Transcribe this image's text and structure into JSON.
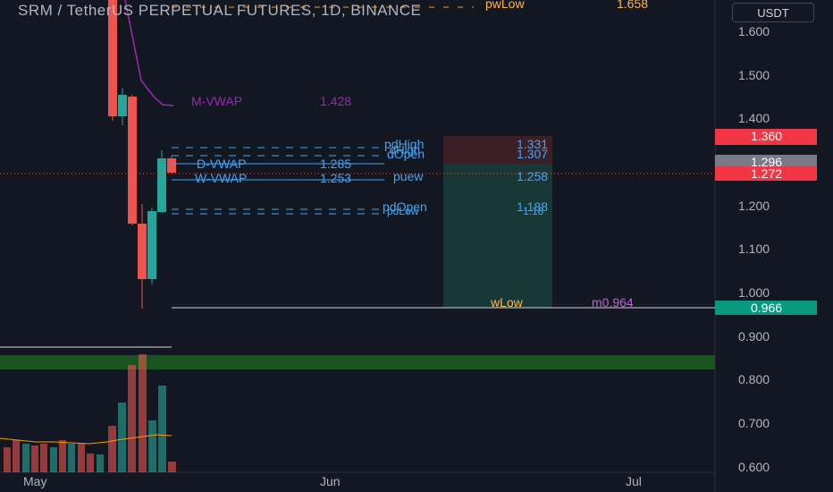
{
  "header": {
    "title": "SRM / TetherUS PERPETUAL FUTURES, 1D, BINANCE",
    "currency": "USDT"
  },
  "price_axis": {
    "ticks": [
      "1.600",
      "1.500",
      "1.400",
      "1.200",
      "1.100",
      "1.000",
      "0.900",
      "0.800",
      "0.700",
      "0.600"
    ],
    "badges": [
      {
        "label": "1.360",
        "color": "#f23645"
      },
      {
        "label": "1.296",
        "color": "#787b86"
      },
      {
        "label": "1.272",
        "color": "#f23645"
      },
      {
        "label": "0.966",
        "color": "#089981"
      }
    ]
  },
  "time_axis": {
    "ticks": [
      "May",
      "Jun",
      "Jul"
    ]
  },
  "indicators": {
    "pw_low_label": "pwLow",
    "pw_low_value": "1.658",
    "m_vwap_label": "M-VWAP",
    "m_vwap_value": "1.428",
    "d_vwap_label": "D-VWAP",
    "d_vwap_value": "1.285",
    "w_vwap_label": "W-VWAP",
    "w_vwap_value": "1.253",
    "w_vwap_extra": "puew",
    "pd_high_label": "pdHigh",
    "pd_high_value": "1.331",
    "d_high_label": "dHigh",
    "d_open_label": "dOpen",
    "d_open_value": "1.307",
    "w_value": "1.258",
    "pd_open_label": "pdOpen",
    "pd_open_value": "1.188",
    "pd_low_label": "pdLow",
    "pd_low_value": "1.18",
    "w_low_label": "wLow",
    "w_low_value": "m0.964"
  },
  "colors": {
    "background": "#131722",
    "up": "#26a69a",
    "down": "#ef5350",
    "vwap_monthly": "#9c27b0",
    "level_lines": "#2962ff",
    "level_text": "#42a5f5",
    "position_short_profit": "#1b3a3a",
    "position_short_loss": "#3a1f26",
    "volume_band": "#1b5e20"
  },
  "chart_data": {
    "type": "candlestick",
    "title": "SRM / TetherUS PERPETUAL FUTURES, 1D, BINANCE",
    "x_axis": "date",
    "y_axis_ticks": [
      1.6,
      1.5,
      1.4,
      1.2,
      1.1,
      1.0,
      0.9,
      0.8,
      0.7,
      0.6
    ],
    "candles": [
      {
        "open": 1.43,
        "high": 1.68,
        "low": 1.38,
        "close": 1.66,
        "direction": "down"
      },
      {
        "open": 1.41,
        "high": 1.46,
        "low": 1.39,
        "close": 1.45,
        "direction": "up"
      },
      {
        "open": 1.44,
        "high": 1.46,
        "low": 1.21,
        "close": 1.23,
        "direction": "down"
      },
      {
        "open": 1.22,
        "high": 1.24,
        "low": 0.97,
        "close": 1.01,
        "direction": "down"
      },
      {
        "open": 1.0,
        "high": 1.21,
        "low": 0.99,
        "close": 1.19,
        "direction": "up"
      },
      {
        "open": 1.19,
        "high": 1.33,
        "low": 1.18,
        "close": 1.3,
        "direction": "up"
      },
      {
        "open": 1.3,
        "high": 1.31,
        "low": 1.27,
        "close": 1.27,
        "direction": "down"
      }
    ],
    "current_price": 1.272,
    "position": {
      "entry": 1.296,
      "stop": 1.36,
      "target": 0.966
    }
  }
}
